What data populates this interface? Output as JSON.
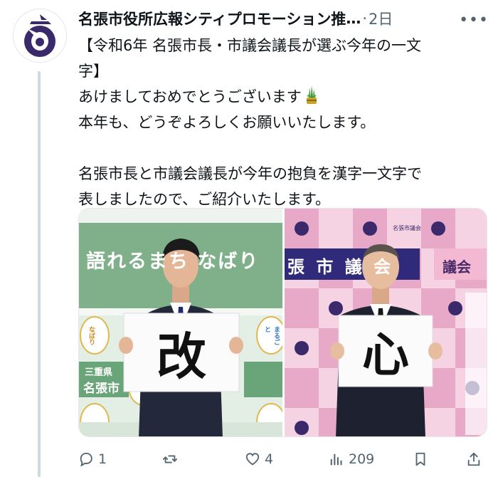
{
  "tweet": {
    "display_name": "名張市役所広報シティプロモーション推",
    "name_suffix": "…",
    "separator": "·",
    "time": "2日",
    "more_label": "•••",
    "text_lines": [
      "【令和6年 名張市長・市議会議長が選ぶ今年の一文",
      "字】",
      "あけましておめでとうございます",
      "本年も、どうぞよろしくお願いいたします。",
      "",
      "名張市長と市議会議長が今年の抱負を漢字一文字で",
      "表しましたので、ご紹介いたします。"
    ]
  },
  "media": {
    "left": {
      "wall_text": "語れるまち なばり",
      "logo_text_top": "なばり",
      "logo_text_bottom": "まるごと",
      "banner_pref": "三重県",
      "banner_city": "名張市",
      "kanji": "改"
    },
    "right": {
      "wall_text": "張 市 議 会",
      "wall_text_right": "議会",
      "label": "名張市議会",
      "kanji": "心"
    }
  },
  "actions": {
    "reply_count": "1",
    "retweet_count": "",
    "like_count": "4",
    "views_count": "209"
  },
  "colors": {
    "text": "#0f1419",
    "secondary": "#536471",
    "logo_purple": "#3b2a6b",
    "thread": "#cfd9de"
  },
  "icons": [
    "city-logo-icon",
    "kadomatsu-icon",
    "reply-icon",
    "retweet-icon",
    "like-icon",
    "views-icon",
    "bookmark-icon",
    "share-icon"
  ]
}
